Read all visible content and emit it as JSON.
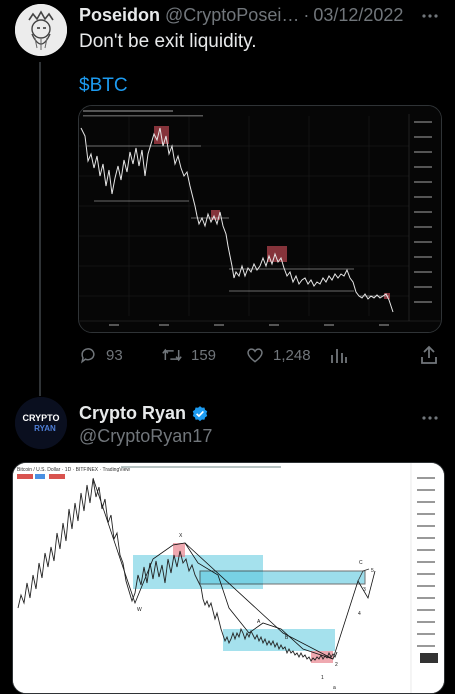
{
  "tweet1": {
    "display_name": "Poseidon",
    "handle": "@CryptoPosei…",
    "separator": "·",
    "date": "03/12/2022",
    "text": "Don't be exit liquidity.",
    "hashtag": "$BTC",
    "more_icon": "more-icon",
    "reply_count": "93",
    "retweet_count": "159",
    "like_count": "1,248"
  },
  "tweet2": {
    "display_name": "Crypto Ryan",
    "handle": "@CryptoRyan17",
    "verified": true,
    "avatar_text_top": "CRYPTO",
    "avatar_text_bottom": "RYAN",
    "chart_header": "Bitcoin / U.S. Dollar · 1D · BITFINEX · TradingView"
  },
  "colors": {
    "background": "#000000",
    "text": "#e7e9ea",
    "muted": "#71767b",
    "link": "#1d9bf0",
    "verified": "#1d9bf0",
    "zone_cyan": "#5bc8df",
    "zone_red": "#e8858f"
  }
}
